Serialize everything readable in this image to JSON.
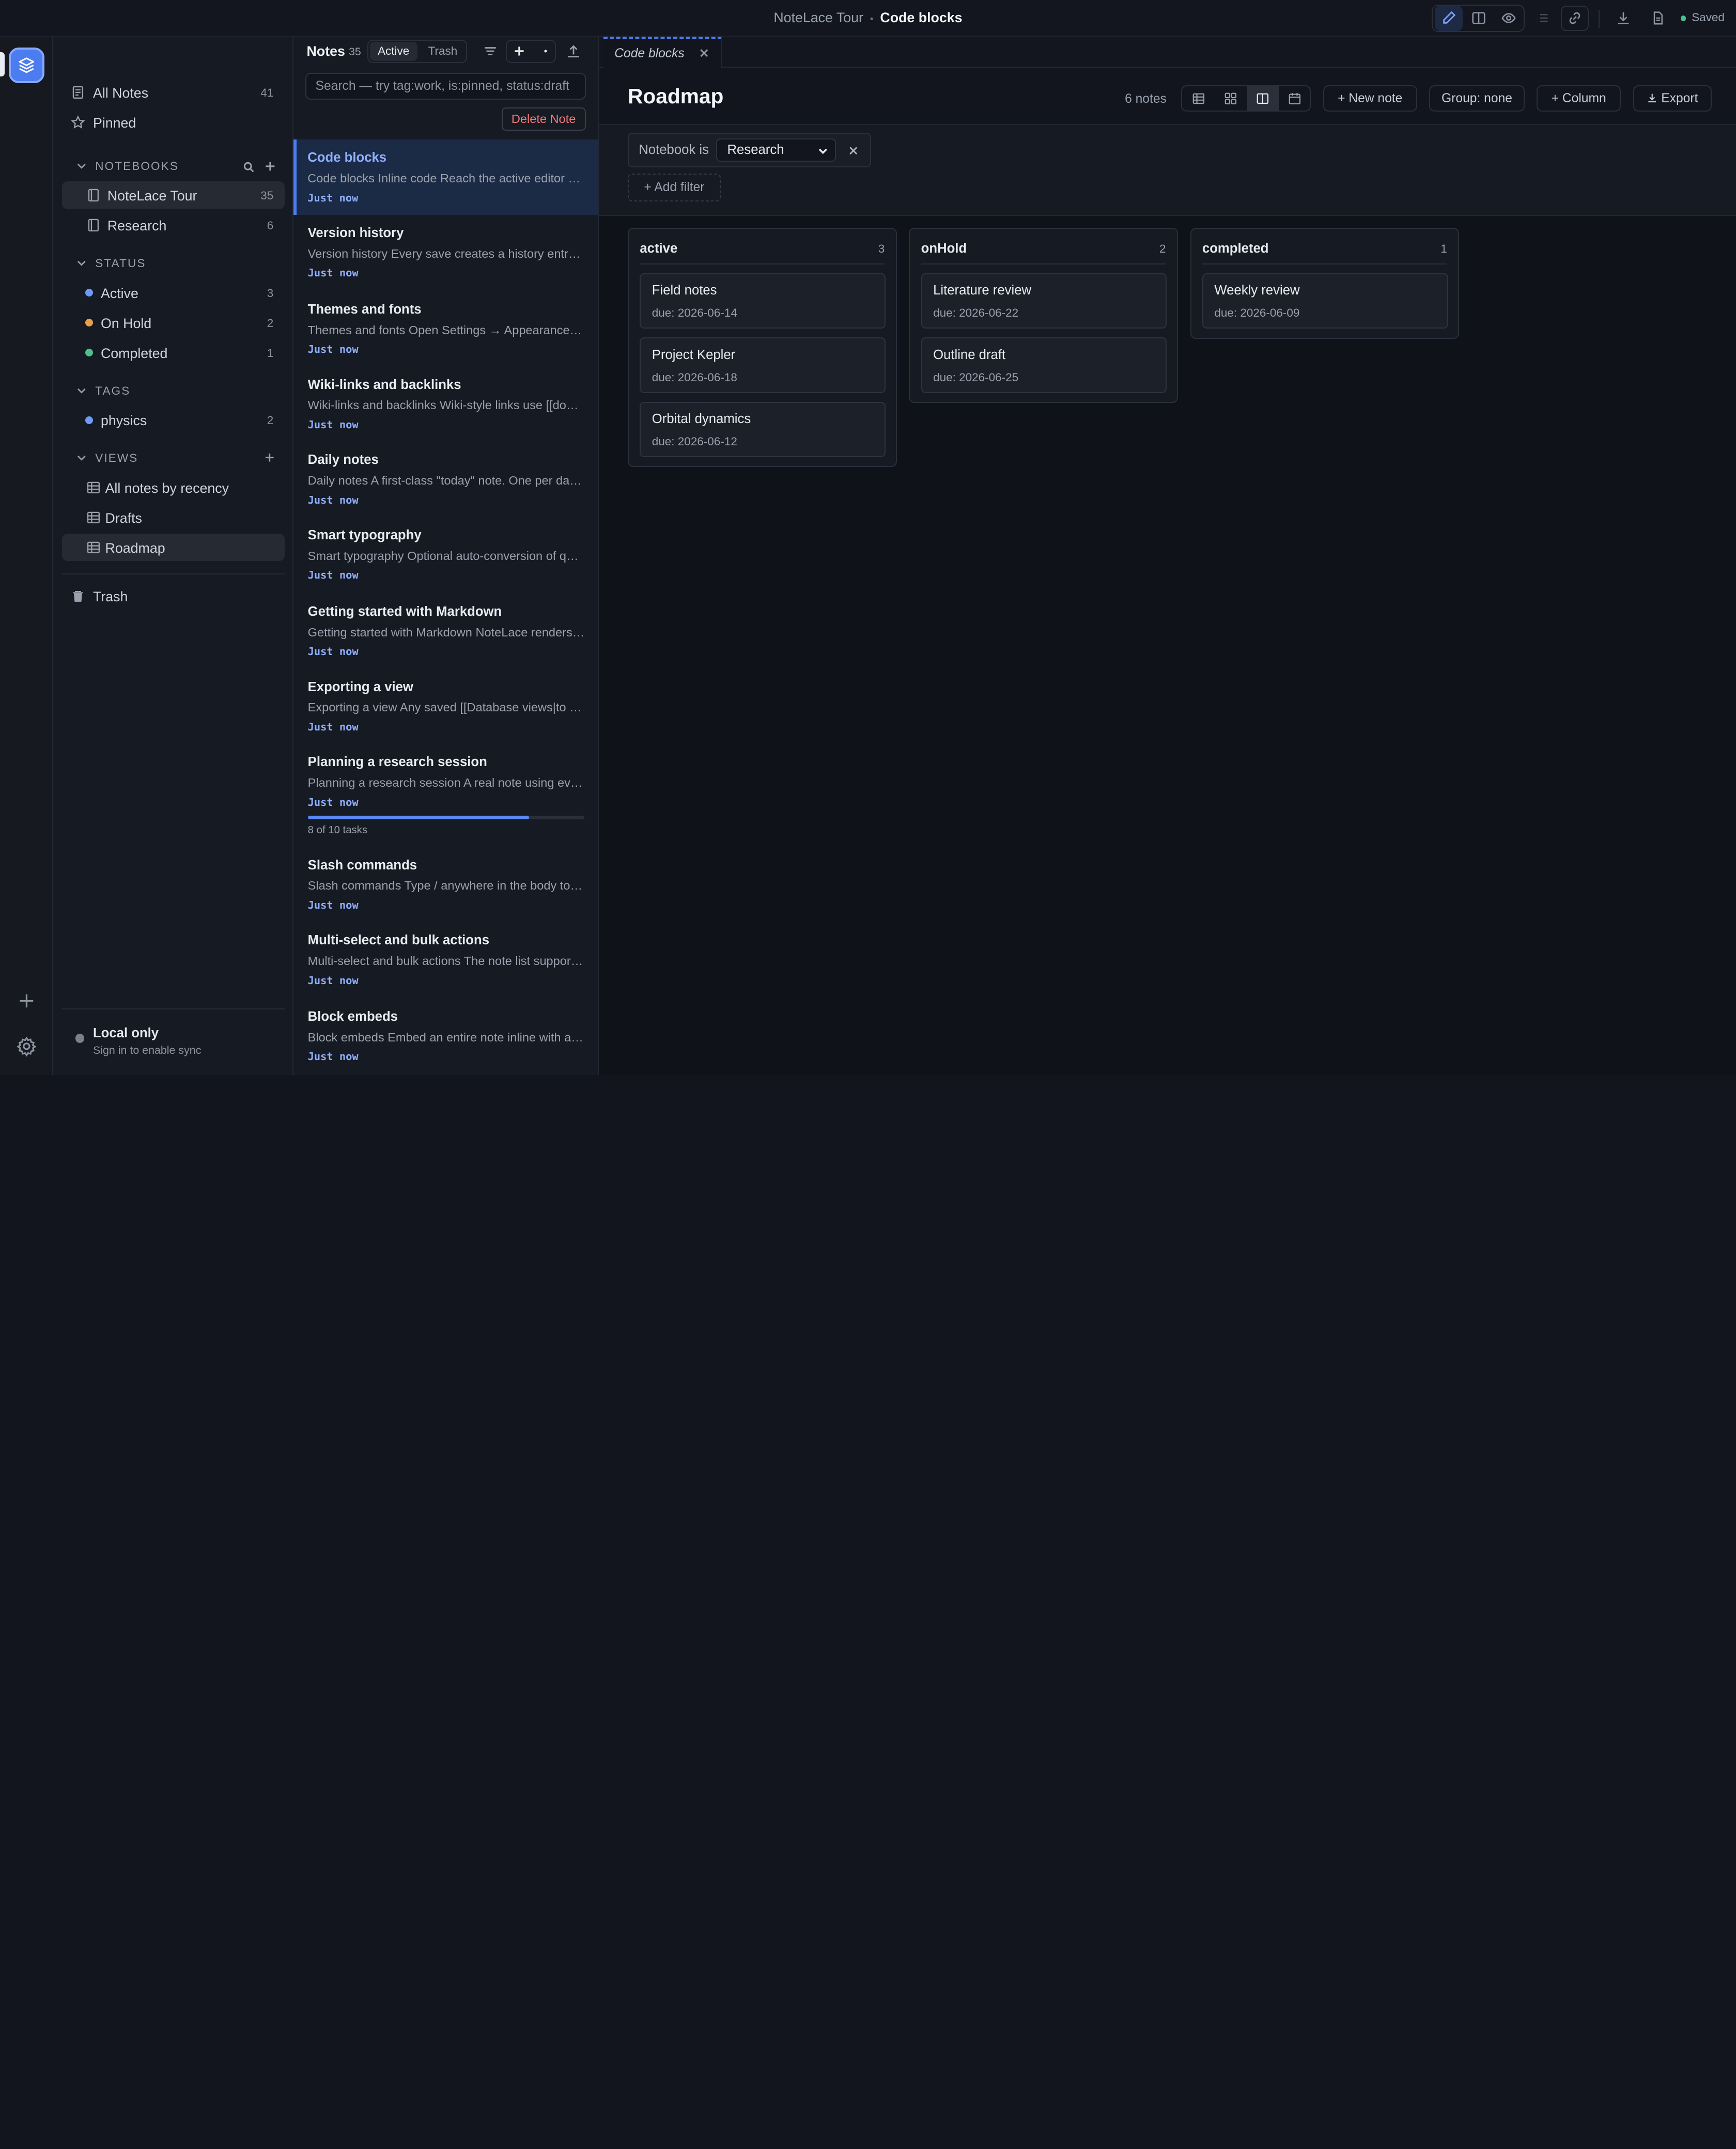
{
  "topbar": {
    "notebook": "NoteLace Tour",
    "separator": "•",
    "current": "Code blocks",
    "saved_label": "Saved"
  },
  "sidebar": {
    "all_notes": {
      "label": "All Notes",
      "count": "41"
    },
    "pinned": {
      "label": "Pinned"
    },
    "notebooks_header": "NOTEBOOKS",
    "notebooks": [
      {
        "label": "NoteLace Tour",
        "count": "35"
      },
      {
        "label": "Research",
        "count": "6"
      }
    ],
    "status_header": "STATUS",
    "status": [
      {
        "label": "Active",
        "count": "3",
        "color": "#6d9bf7"
      },
      {
        "label": "On Hold",
        "count": "2",
        "color": "#e8a04a"
      },
      {
        "label": "Completed",
        "count": "1",
        "color": "#4fc08d"
      }
    ],
    "tags_header": "TAGS",
    "tags": [
      {
        "label": "physics",
        "count": "2",
        "color": "#6d9bf7"
      }
    ],
    "views_header": "VIEWS",
    "views": [
      {
        "label": "All notes by recency"
      },
      {
        "label": "Drafts"
      },
      {
        "label": "Roadmap"
      }
    ],
    "trash": "Trash",
    "sync": {
      "title": "Local only",
      "subtitle": "Sign in to enable sync"
    }
  },
  "notes_panel": {
    "title": "Notes",
    "count": "35",
    "seg_active": "Active",
    "seg_trash": "Trash",
    "search_placeholder": "Search — try tag:work, is:pinned, status:draft",
    "delete_label": "Delete Note",
    "notes": [
      {
        "title": "Code blocks",
        "preview": "Code blocks Inline code Reach the active editor with a fenced code block",
        "date": "Just now"
      },
      {
        "title": "Version history",
        "preview": "Version history Every save creates a history entry you can restore",
        "date": "Just now"
      },
      {
        "title": "Themes and fonts",
        "preview": "Themes and fonts Open Settings → Appearance to pick a theme",
        "date": "Just now"
      },
      {
        "title": "Wiki-links and backlinks",
        "preview": "Wiki-links and backlinks Wiki-style links use [[double brackets]]",
        "date": "Just now"
      },
      {
        "title": "Daily notes",
        "preview": "Daily notes A first-class \"today\" note. One per day, created on demand",
        "date": "Just now"
      },
      {
        "title": "Smart typography",
        "preview": "Smart typography Optional auto-conversion of quotes and dashes",
        "date": "Just now"
      },
      {
        "title": "Getting started with Markdown",
        "preview": "Getting started with Markdown NoteLace renders Markdown as you type",
        "date": "Just now"
      },
      {
        "title": "Exporting a view",
        "preview": "Exporting a view Any saved [[Database views|to a file]]",
        "date": "Just now"
      },
      {
        "title": "Planning a research session",
        "preview": "Planning a research session A real note using everything together",
        "date": "Just now"
      },
      {
        "title": "Slash commands",
        "preview": "Slash commands Type / anywhere in the body to insert blocks",
        "date": "Just now"
      },
      {
        "title": "Multi-select and bulk actions",
        "preview": "Multi-select and bulk actions The note list supports shift-click",
        "date": "Just now"
      },
      {
        "title": "Block embeds",
        "preview": "Block embeds Embed an entire note inline with a transclusion",
        "date": "Just now"
      }
    ],
    "tasks": {
      "label": "8 of 10 tasks",
      "done": 8,
      "total": 10
    }
  },
  "main": {
    "tab_label": "Code blocks",
    "view_title": "Roadmap",
    "note_count": "6 notes",
    "new_note": "New note",
    "group": "Group: none",
    "column": "Column",
    "export": "Export",
    "filter": {
      "label": "Notebook is",
      "value": "Research"
    },
    "add_filter": "Add filter",
    "columns": [
      {
        "name": "active",
        "count": "3",
        "cards": [
          {
            "title": "Field notes",
            "due": "due: 2026-06-14"
          },
          {
            "title": "Project Kepler",
            "due": "due: 2026-06-18"
          },
          {
            "title": "Orbital dynamics",
            "due": "due: 2026-06-12"
          }
        ]
      },
      {
        "name": "onHold",
        "count": "2",
        "cards": [
          {
            "title": "Literature review",
            "due": "due: 2026-06-22"
          },
          {
            "title": "Outline draft",
            "due": "due: 2026-06-25"
          }
        ]
      },
      {
        "name": "completed",
        "count": "1",
        "cards": [
          {
            "title": "Weekly review",
            "due": "due: 2026-06-09"
          }
        ]
      }
    ]
  }
}
